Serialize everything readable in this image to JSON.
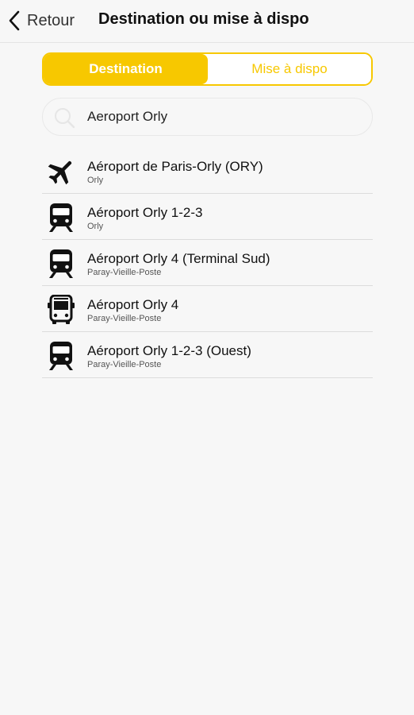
{
  "header": {
    "back_label": "Retour",
    "title": "Destination ou mise à dispo"
  },
  "segmented": {
    "tabs": [
      {
        "label": "Destination",
        "active": true
      },
      {
        "label": "Mise à dispo",
        "active": false
      }
    ]
  },
  "search": {
    "value": "Aeroport Orly",
    "icon": "search-icon"
  },
  "results": [
    {
      "icon": "plane-icon",
      "title": "Aéroport de Paris-Orly (ORY)",
      "subtitle": "Orly"
    },
    {
      "icon": "train-icon",
      "title": "Aéroport Orly 1-2-3",
      "subtitle": "Orly"
    },
    {
      "icon": "train-icon",
      "title": "Aéroport Orly 4 (Terminal Sud)",
      "subtitle": "Paray-Vieille-Poste"
    },
    {
      "icon": "bus-icon",
      "title": "Aéroport Orly 4",
      "subtitle": "Paray-Vieille-Poste"
    },
    {
      "icon": "train-icon",
      "title": "Aéroport Orly 1-2-3 (Ouest)",
      "subtitle": "Paray-Vieille-Poste"
    }
  ],
  "colors": {
    "accent": "#f7c800",
    "background": "#f7f7f7"
  }
}
